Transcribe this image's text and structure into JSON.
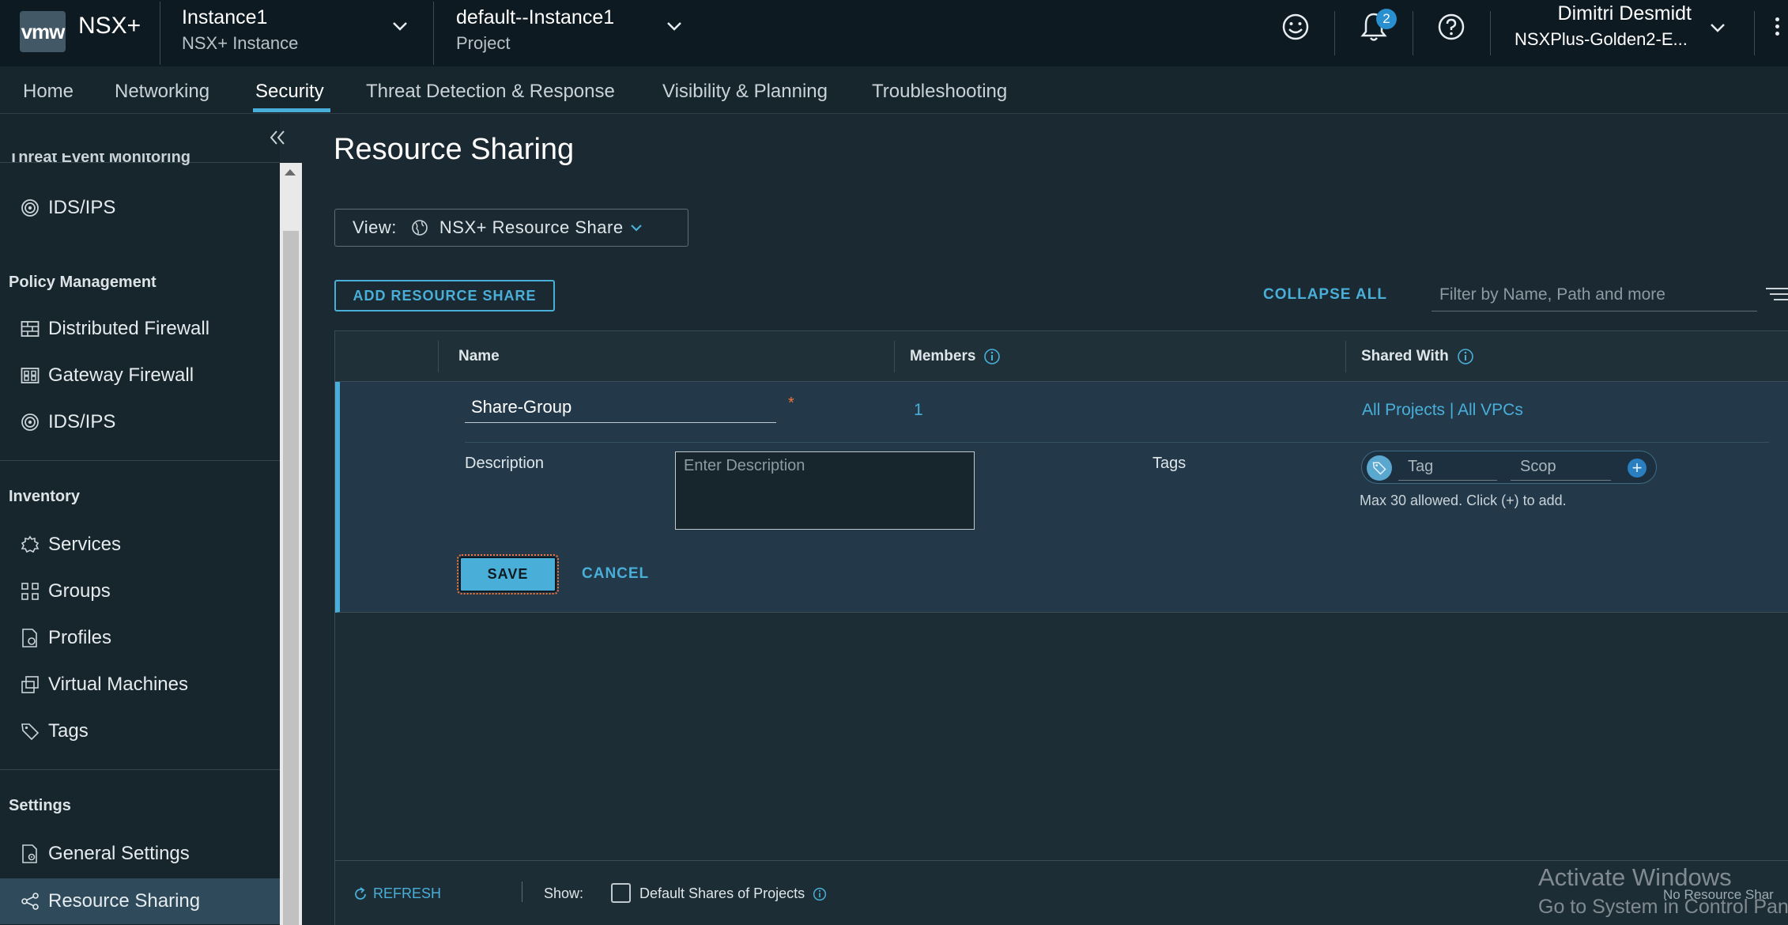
{
  "header": {
    "logo": "vmw",
    "app_name": "NSX+",
    "instance_title": "Instance1",
    "instance_subtitle": "NSX+ Instance",
    "project_title": "default--Instance1",
    "project_subtitle": "Project",
    "notifications_count": "2",
    "user_name": "Dimitri Desmidt",
    "user_org": "NSXPlus-Golden2-E...",
    "icons": [
      "smiley-icon",
      "bell-icon",
      "help-icon",
      "chevron-down-icon",
      "kebab-menu-icon"
    ]
  },
  "nav": {
    "tabs": [
      {
        "label": "Home"
      },
      {
        "label": "Networking"
      },
      {
        "label": "Security"
      },
      {
        "label": "Threat Detection & Response"
      },
      {
        "label": "Visibility & Planning"
      },
      {
        "label": "Troubleshooting"
      }
    ],
    "active": "Security",
    "accent_color": "#49afd9"
  },
  "sidebar": {
    "truncated_section": "Threat Event Monitoring",
    "sections": [
      {
        "items": [
          {
            "label": "IDS/IPS",
            "icon": "target-icon"
          }
        ]
      },
      {
        "title": "Policy Management",
        "items": [
          {
            "label": "Distributed Firewall",
            "icon": "firewall-icon"
          },
          {
            "label": "Gateway Firewall",
            "icon": "gateway-firewall-icon"
          },
          {
            "label": "IDS/IPS",
            "icon": "target-icon"
          }
        ]
      },
      {
        "title": "Inventory",
        "items": [
          {
            "label": "Services",
            "icon": "services-icon"
          },
          {
            "label": "Groups",
            "icon": "groups-icon"
          },
          {
            "label": "Profiles",
            "icon": "profiles-icon"
          },
          {
            "label": "Virtual Machines",
            "icon": "vm-icon"
          },
          {
            "label": "Tags",
            "icon": "tag-icon"
          }
        ]
      },
      {
        "title": "Settings",
        "items": [
          {
            "label": "General Settings",
            "icon": "settings-doc-icon"
          },
          {
            "label": "Resource Sharing",
            "icon": "share-icon"
          }
        ]
      }
    ],
    "active": "Resource Sharing"
  },
  "main": {
    "title": "Resource Sharing",
    "view_label": "View:",
    "view_value": "NSX+ Resource Share",
    "add_button": "ADD RESOURCE SHARE",
    "collapse_all": "COLLAPSE ALL",
    "filter_placeholder": "Filter by Name, Path and more",
    "columns": [
      "Name",
      "Members",
      "Shared With"
    ],
    "edit_row": {
      "name_value": "Share-Group",
      "required_mark": "*",
      "members": "1",
      "shared_with": "All Projects | All VPCs",
      "description_label": "Description",
      "description_placeholder": "Enter Description",
      "tags_label": "Tags",
      "tag_placeholder": "Tag",
      "scope_placeholder": "Scop",
      "tag_add": "+",
      "tags_hint": "Max 30 allowed. Click (+) to add.",
      "save": "SAVE",
      "cancel": "CANCEL"
    },
    "footer": {
      "refresh": "REFRESH",
      "show_label": "Show:",
      "checkbox_label": "Default Shares of Projects",
      "checkbox_checked": false,
      "status": "No Resource Shar"
    }
  },
  "watermark": {
    "line1": "Activate Windows",
    "line2": "Go to System in Control Pane"
  }
}
